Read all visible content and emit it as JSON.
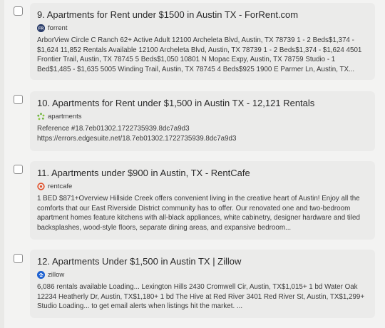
{
  "results": [
    {
      "title": "9. Apartments for Rent under $1500 in Austin TX - ForRent.com",
      "source": "forrent",
      "icon": "forrent-icon",
      "snippet": "ArborView Circle C Ranch 62+ Active Adult 12100 Archeleta Blvd, Austin, TX 78739 1 - 2 Beds$1,374 - $1,624 11,852 Rentals Available 12100 Archeleta Blvd, Austin, TX 78739 1 - 2 Beds$1,374 - $1,624 4501 Frontier Trail, Austin, TX 78745 5 Beds$1,050 10801 N Mopac Expy, Austin, TX 78759 Studio - 1 Bed$1,485 - $1,635 5005 Winding Trail, Austin, TX 78745 4 Beds$925 1900 E Parmer Ln, Austin, TX..."
    },
    {
      "title": "10. Apartments for Rent under $1,500 in Austin TX - 12,121 Rentals",
      "source": "apartments",
      "icon": "apartments-icon",
      "snippet": "Reference #18.7eb01302.1722735939.8dc7a9d3\nhttps://errors.edgesuite.net/18.7eb01302.1722735939.8dc7a9d3"
    },
    {
      "title": "11. Apartments under $900 in Austin, TX - RentCafe",
      "source": "rentcafe",
      "icon": "rentcafe-icon",
      "snippet": "1 BED $871+Overview Hillside Creek offers convenient living in the creative heart of Austin! Enjoy all the comforts that our East Riverside District community has to offer. Our renovated one and two-bedroom apartment homes feature kitchens with all-black appliances, white cabinetry, designer hardware and tiled backsplashes, wood-style floors, separate dining areas, and expansive bedroom..."
    },
    {
      "title": "12. Apartments Under $1,500 in Austin TX | Zillow",
      "source": "zillow",
      "icon": "zillow-icon",
      "snippet": "6,086 rentals available Loading... Lexington Hills 2430 Cromwell Cir, Austin, TX$1,015+ 1 bd Water Oak 12234 Heatherly Dr, Austin, TX$1,180+ 1 bd The Hive at Red River 3401 Red River St, Austin, TX$1,299+ Studio Loading... to get email alerts when listings hit the market. ..."
    }
  ],
  "colors": {
    "card_bg": "#ebebea",
    "page_bg": "#f3f3f2",
    "forrent": "#2c3e6b",
    "apartments": "#6bb33c",
    "rentcafe": "#e2502a",
    "zillow": "#1a5fd0"
  }
}
